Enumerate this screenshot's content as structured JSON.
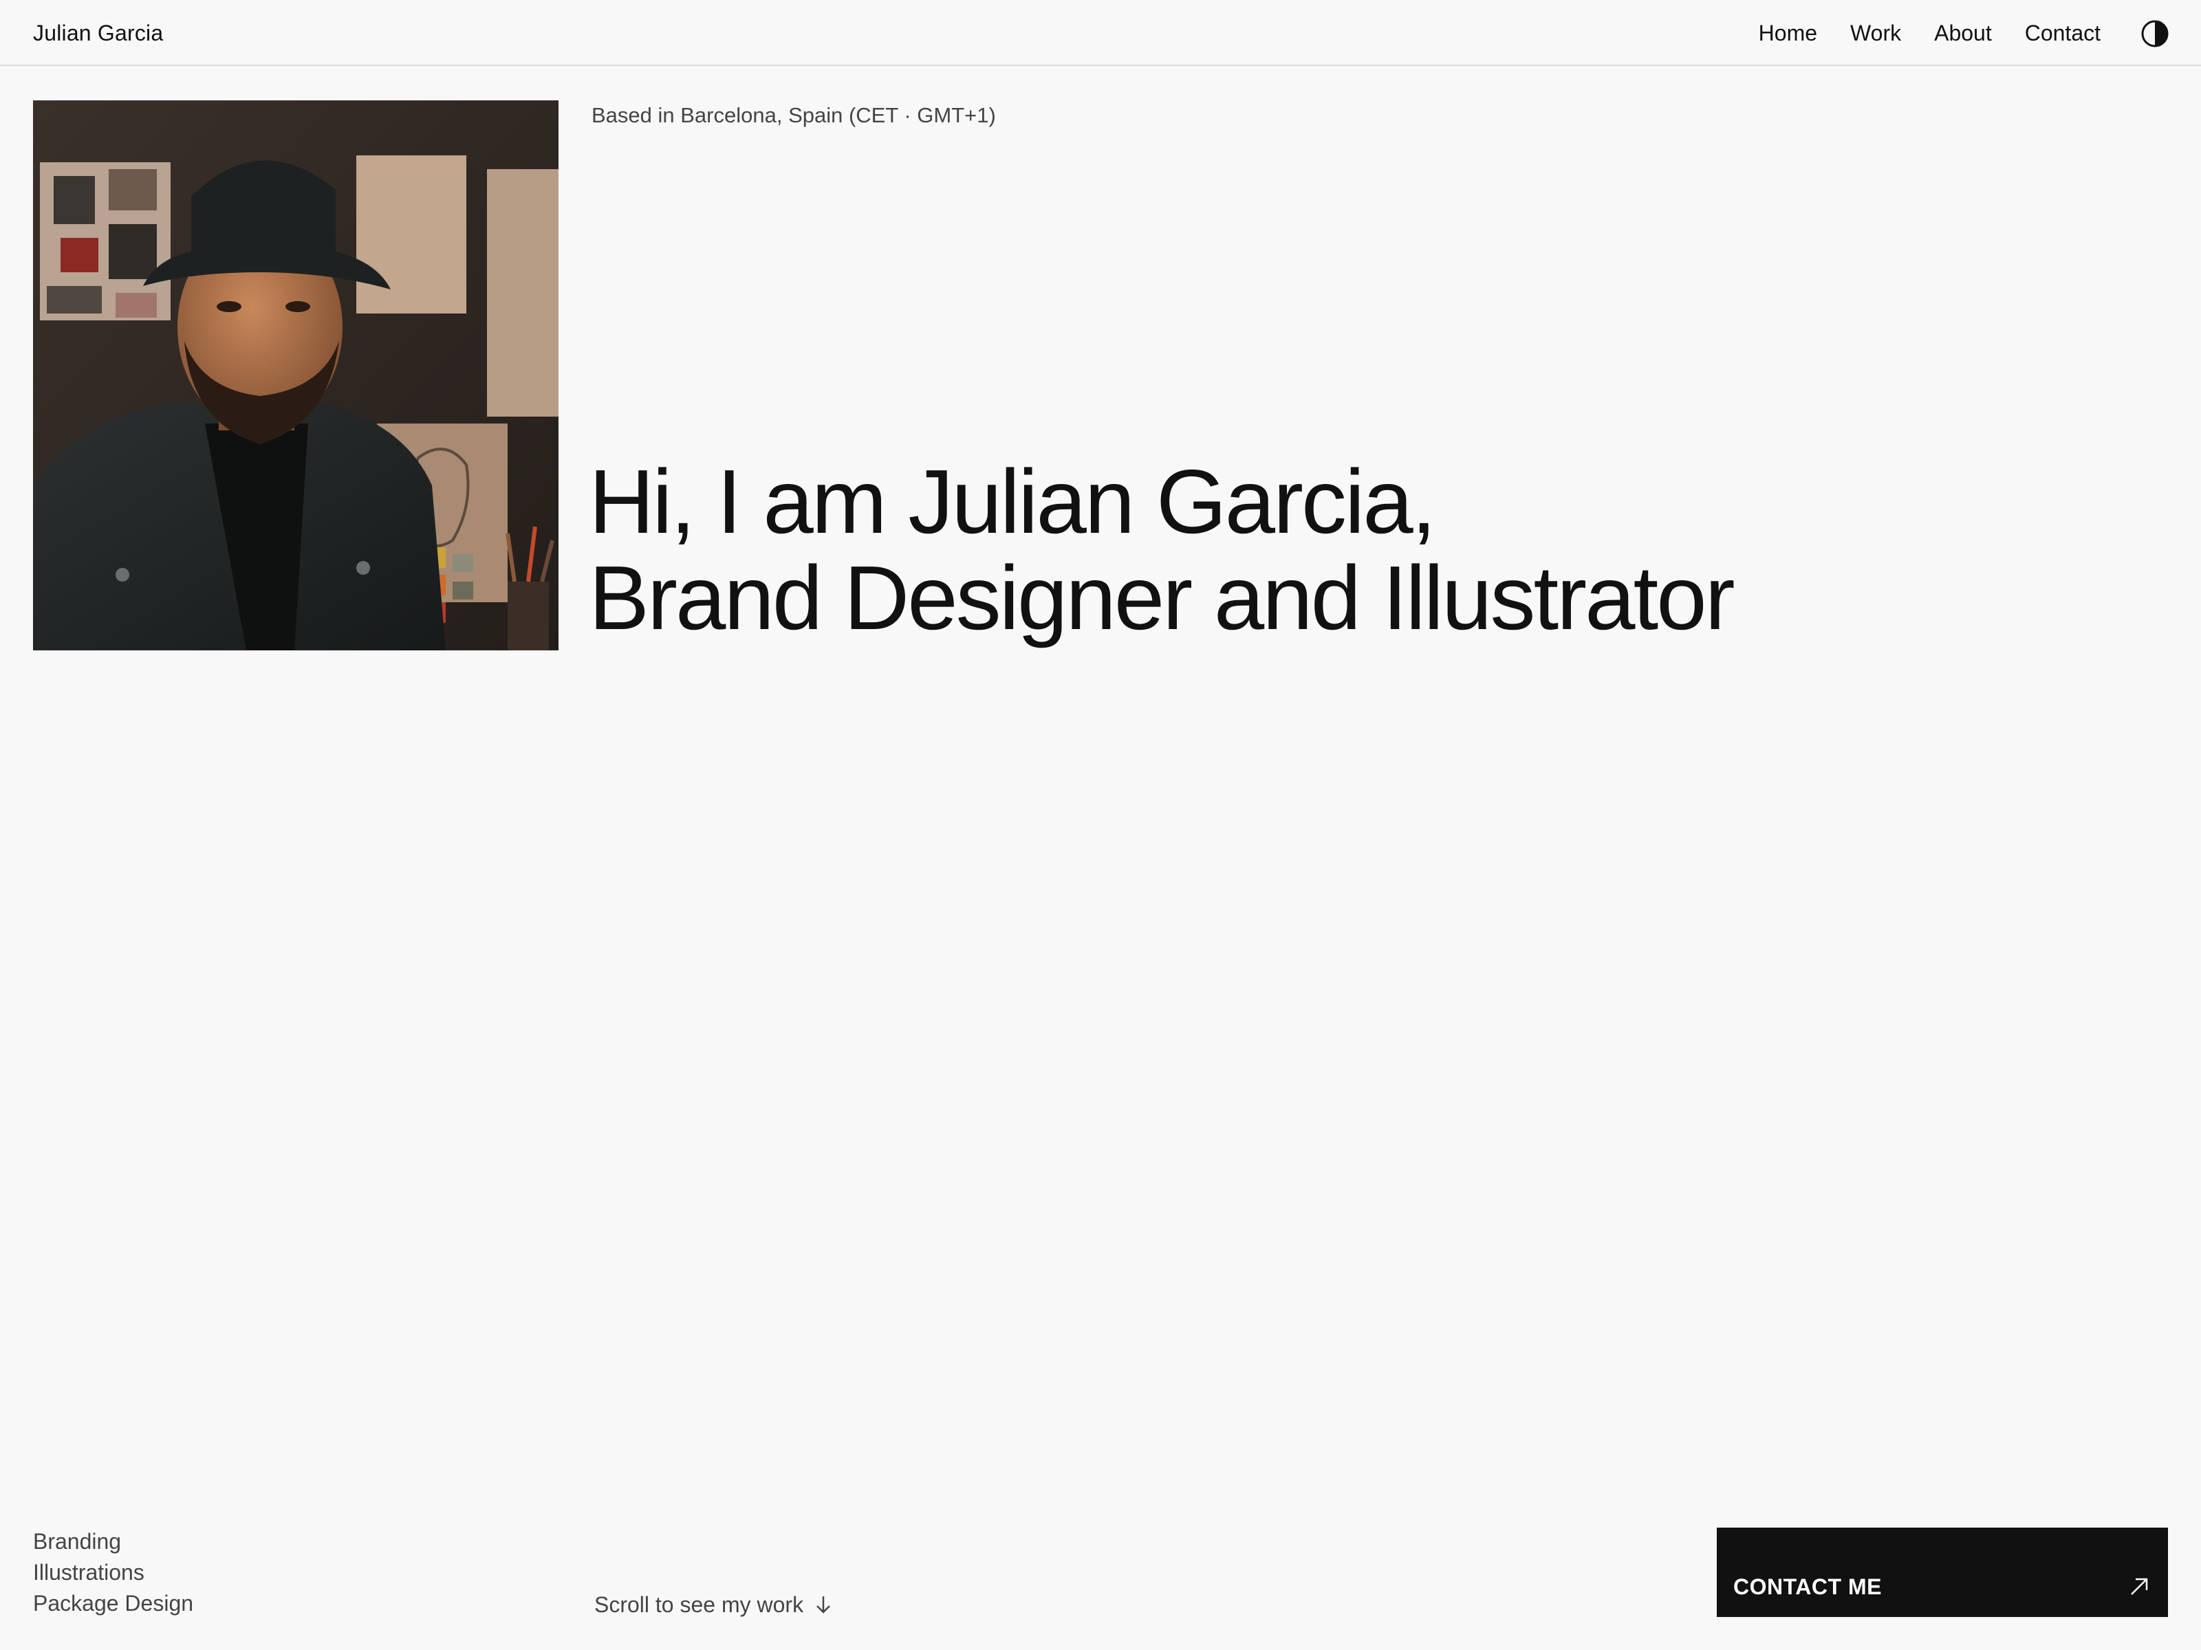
{
  "header": {
    "brand": "Julian Garcia",
    "nav": [
      {
        "label": "Home"
      },
      {
        "label": "Work"
      },
      {
        "label": "About"
      },
      {
        "label": "Contact"
      }
    ],
    "theme_toggle_icon": "contrast-half-circle-icon"
  },
  "hero": {
    "location": "Based in Barcelona, Spain (CET · GMT+1)",
    "headline_line1": "Hi, I am Julian Garcia,",
    "headline_line2": "Brand Designer and Illustrator",
    "portrait_icon": "portrait-photo"
  },
  "services": [
    "Branding",
    "Illustrations",
    "Package Design"
  ],
  "scroll_hint": {
    "label": "Scroll to see my work",
    "icon": "arrow-down-icon"
  },
  "cta": {
    "label": "CONTACT ME",
    "icon": "arrow-up-right-icon"
  },
  "colors": {
    "background": "#f8f8f8",
    "text": "#111111",
    "muted": "#444444",
    "button": "#111111"
  }
}
